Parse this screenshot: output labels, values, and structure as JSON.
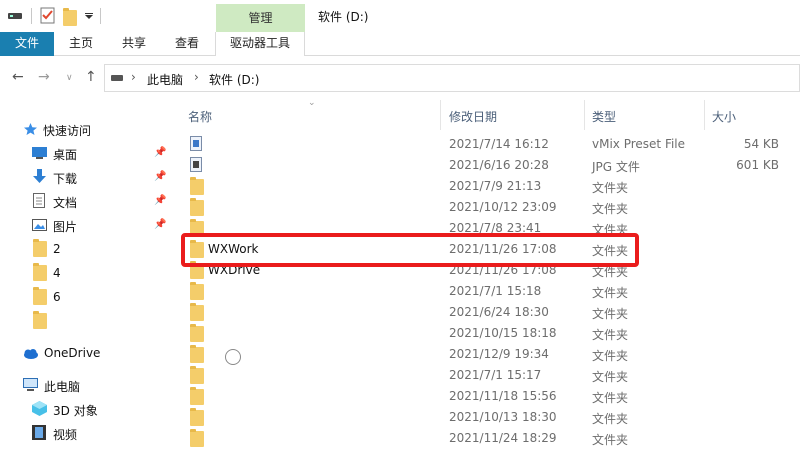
{
  "titlebar": {
    "window_title": "软件 (D:)",
    "manage_tab": "管理",
    "qa_icons": [
      "drive-icon",
      "checklist-icon",
      "folder-icon",
      "dropdown-arrow-icon"
    ]
  },
  "ribbon": {
    "tabs": [
      "文件",
      "主页",
      "共享",
      "查看",
      "驱动器工具"
    ],
    "accent": "#1a7fb0",
    "manage_color": "#cfeac2"
  },
  "address": {
    "breadcrumb": [
      "此电脑",
      "软件 (D:)"
    ]
  },
  "nav": {
    "quick_access": "快速访问",
    "items": [
      {
        "label": "桌面",
        "icon": "desktop-icon",
        "pinned": true
      },
      {
        "label": "下载",
        "icon": "download-icon",
        "pinned": true
      },
      {
        "label": "文档",
        "icon": "document-icon",
        "pinned": true
      },
      {
        "label": "图片",
        "icon": "picture-icon",
        "pinned": true
      },
      {
        "label": "2",
        "icon": "folder-icon",
        "pinned": false
      },
      {
        "label": "4",
        "icon": "folder-icon",
        "pinned": false
      },
      {
        "label": "6",
        "icon": "folder-icon",
        "pinned": false
      },
      {
        "label": "",
        "icon": "folder-icon",
        "pinned": false
      }
    ],
    "onedrive": "OneDrive",
    "this_pc": "此电脑",
    "pc_items": [
      {
        "label": "3D 对象",
        "icon": "3d-objects-icon"
      },
      {
        "label": "视频",
        "icon": "video-icon"
      }
    ]
  },
  "columns": {
    "name": "名称",
    "date": "修改日期",
    "type": "类型",
    "size": "大小"
  },
  "files": [
    {
      "name": "",
      "date": "2021/7/14 16:12",
      "type": "vMix Preset File",
      "size": "54 KB",
      "icon": "preset-file-icon"
    },
    {
      "name": "",
      "date": "2021/6/16 20:28",
      "type": "JPG 文件",
      "size": "601 KB",
      "icon": "jpg-file-icon"
    },
    {
      "name": "",
      "date": "2021/7/9 21:13",
      "type": "文件夹",
      "size": "",
      "icon": "folder-icon"
    },
    {
      "name": "",
      "date": "2021/10/12 23:09",
      "type": "文件夹",
      "size": "",
      "icon": "folder-icon"
    },
    {
      "name": "",
      "date": "2021/7/8 23:41",
      "type": "文件夹",
      "size": "",
      "icon": "folder-icon"
    },
    {
      "name": "WXWork",
      "date": "2021/11/26 17:08",
      "type": "文件夹",
      "size": "",
      "icon": "folder-icon"
    },
    {
      "name": "WXDrive",
      "date": "2021/11/26 17:08",
      "type": "文件夹",
      "size": "",
      "icon": "folder-icon"
    },
    {
      "name": "",
      "date": "2021/7/1 15:18",
      "type": "文件夹",
      "size": "",
      "icon": "folder-icon"
    },
    {
      "name": "",
      "date": "2021/6/24 18:30",
      "type": "文件夹",
      "size": "",
      "icon": "folder-icon"
    },
    {
      "name": "",
      "date": "2021/10/15 18:18",
      "type": "文件夹",
      "size": "",
      "icon": "folder-icon"
    },
    {
      "name": "",
      "date": "2021/12/9 19:34",
      "type": "文件夹",
      "size": "",
      "icon": "folder-icon"
    },
    {
      "name": "",
      "date": "2021/7/1 15:17",
      "type": "文件夹",
      "size": "",
      "icon": "folder-icon"
    },
    {
      "name": "",
      "date": "2021/11/18 15:56",
      "type": "文件夹",
      "size": "",
      "icon": "folder-icon"
    },
    {
      "name": "",
      "date": "2021/10/13 18:30",
      "type": "文件夹",
      "size": "",
      "icon": "folder-icon"
    },
    {
      "name": "",
      "date": "2021/11/24 18:29",
      "type": "文件夹",
      "size": "",
      "icon": "folder-icon"
    }
  ],
  "highlight_color": "#ea1c1c"
}
